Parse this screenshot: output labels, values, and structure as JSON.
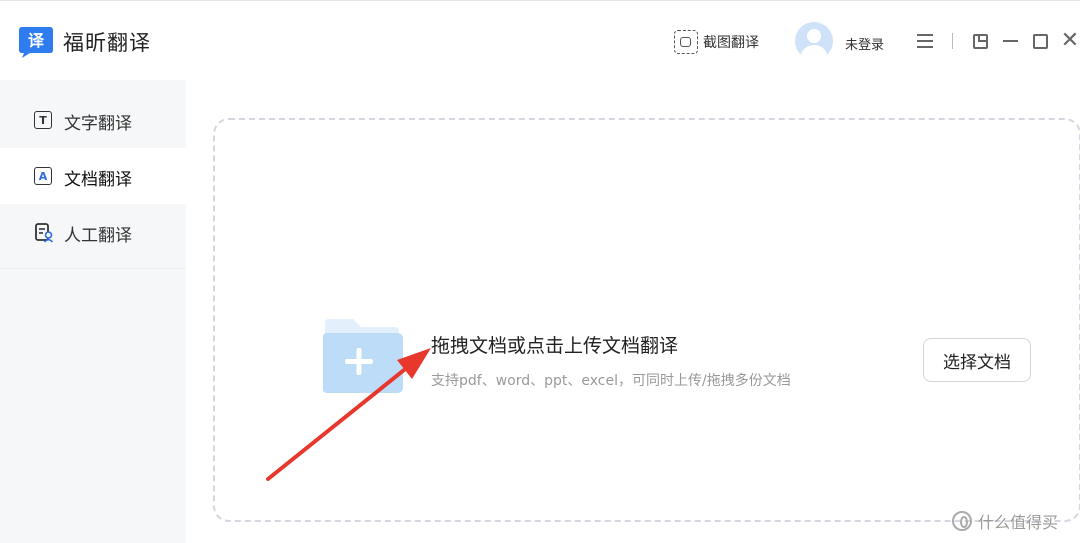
{
  "app": {
    "name": "福昕翻译",
    "logo_glyph": "译",
    "brand_color": "#2f7bf0"
  },
  "titlebar": {
    "screenshot_translate_label": "截图翻译",
    "login_status": "未登录",
    "icons": {
      "menu": "menu-icon",
      "pin": "pin-icon",
      "minimize": "minimize-icon",
      "maximize": "maximize-icon",
      "close": "close-icon",
      "close_glyph": "✕"
    }
  },
  "sidebar": {
    "items": [
      {
        "label": "文字翻译",
        "icon": "text-translate-icon",
        "glyph": "T",
        "active": false
      },
      {
        "label": "文档翻译",
        "icon": "document-translate-icon",
        "glyph": "A",
        "active": true
      },
      {
        "label": "人工翻译",
        "icon": "human-translate-icon",
        "glyph": "",
        "active": false
      }
    ]
  },
  "upload": {
    "title": "拖拽文档或点击上传文档翻译",
    "hint": "支持pdf、word、ppt、excel，可同时上传/拖拽多份文档",
    "button_label": "选择文档",
    "folder_color": "#bcdcf8"
  },
  "annotation": {
    "arrow_color": "#e8372c"
  },
  "watermark": {
    "text": "什么值得买"
  }
}
